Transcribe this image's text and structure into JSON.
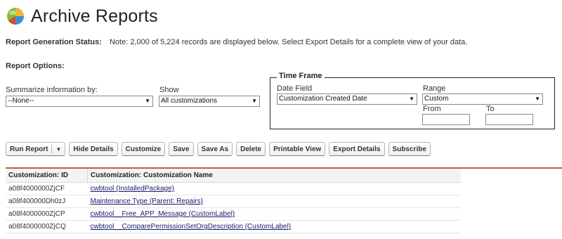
{
  "page": {
    "title": "Archive Reports"
  },
  "status": {
    "label": "Report Generation Status:",
    "note": "Note: 2,000 of 5,224 records are displayed below. Select Export Details for a complete view of your data."
  },
  "options": {
    "label": "Report Options:",
    "summarize_label": "Summarize information by:",
    "summarize_value": "--None--",
    "show_label": "Show",
    "show_value": "All customizations"
  },
  "timeframe": {
    "legend": "Time Frame",
    "date_field_label": "Date Field",
    "date_field_value": "Customization Created Date",
    "range_label": "Range",
    "range_value": "Custom",
    "from_label": "From",
    "to_label": "To",
    "from_value": "",
    "to_value": ""
  },
  "toolbar": {
    "run_report": "Run Report",
    "hide_details": "Hide Details",
    "customize": "Customize",
    "save": "Save",
    "save_as": "Save As",
    "delete": "Delete",
    "printable_view": "Printable View",
    "export_details": "Export Details",
    "subscribe": "Subscribe"
  },
  "table": {
    "columns": [
      "Customization: ID",
      "Customization: Customization Name"
    ],
    "rows": [
      [
        "a08f4000000ZjCF",
        "cwbtool (InstalledPackage)"
      ],
      [
        "a08f400000Dh0zJ",
        "Maintenance Type (Parent: Repairs)"
      ],
      [
        "a08f4000000ZjCP",
        "cwbtool__Free_APP_Message (CustomLabel)"
      ],
      [
        "a08f4000000ZjCQ",
        "cwbtool__ComparePermissionSetOrgDescription (CustomLabel)"
      ]
    ]
  },
  "icons": {
    "logo": "reports-logo-icon",
    "dropdown": "chevron-down-icon"
  },
  "colors": {
    "accent_line": "#c25a4a",
    "link": "#1a1a6e"
  }
}
